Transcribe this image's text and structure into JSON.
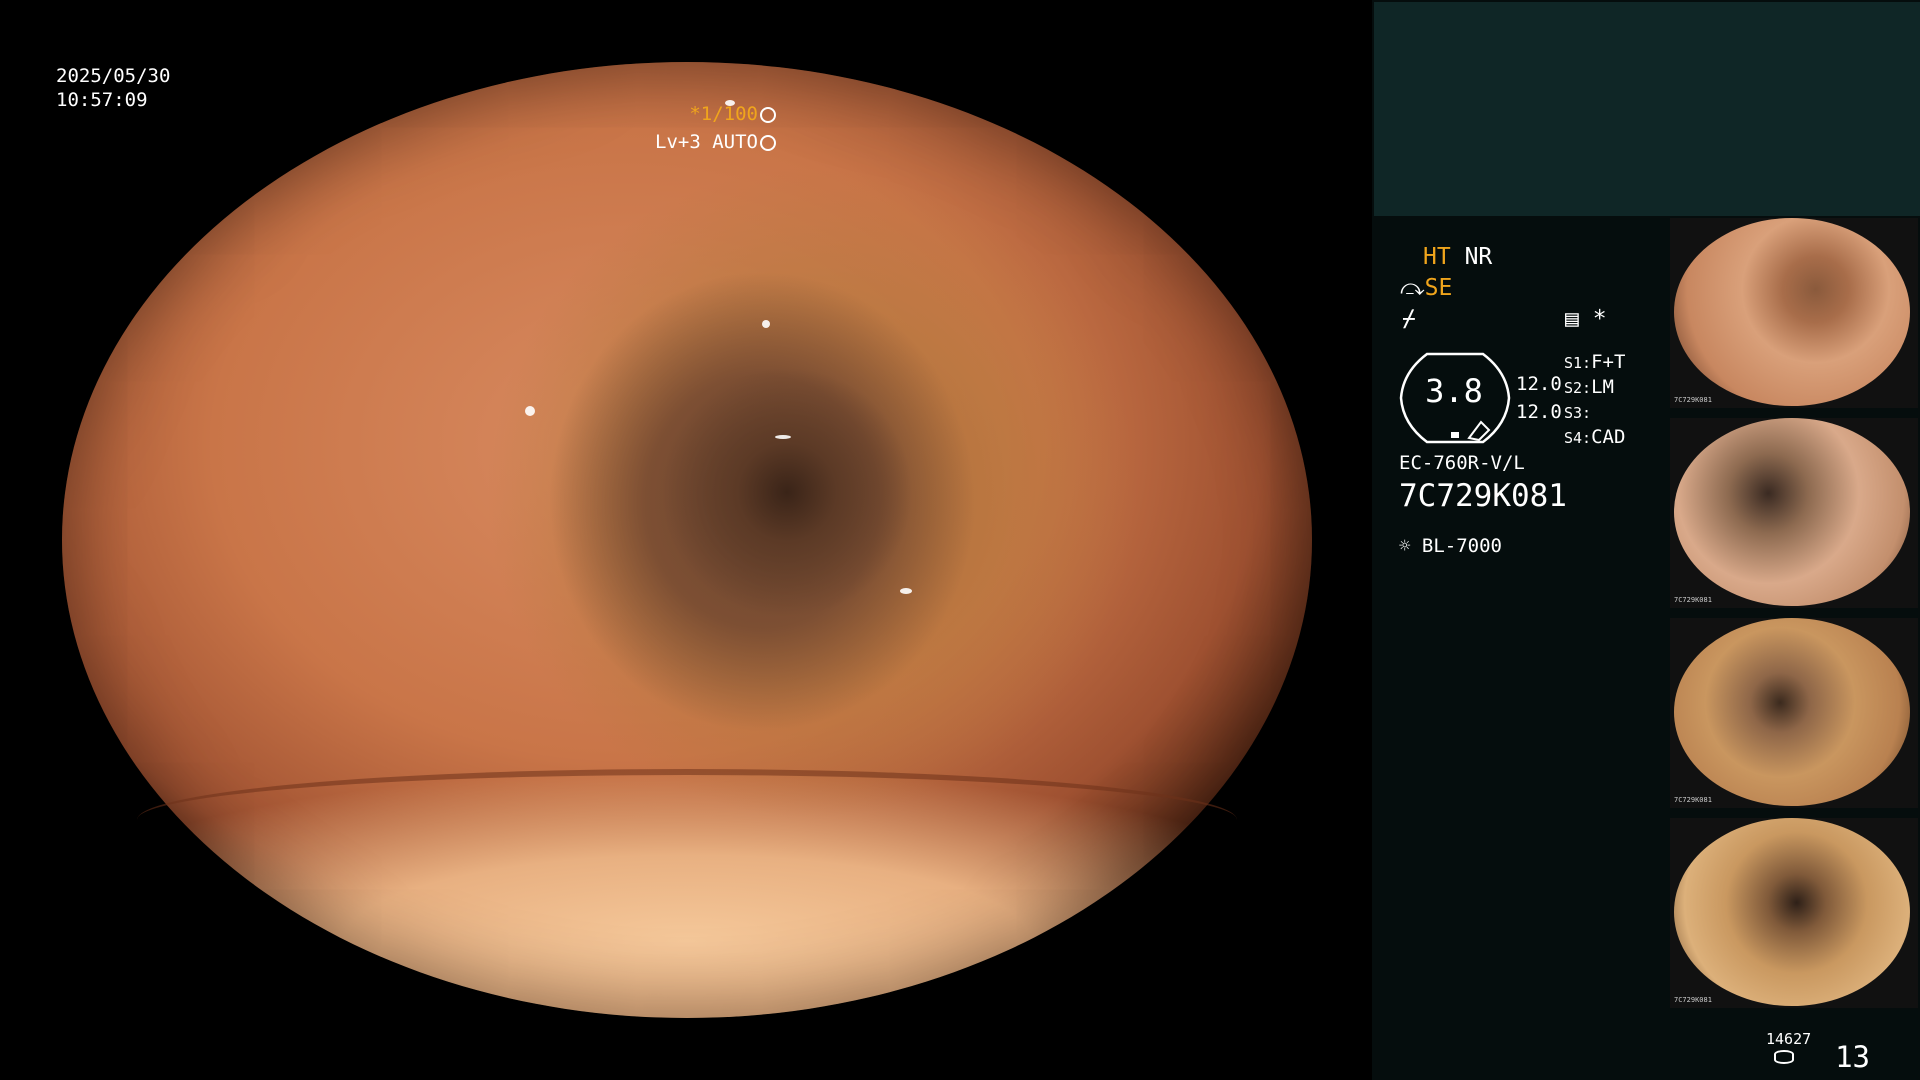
{
  "main": {
    "date": "2025/05/30",
    "time": "10:57:09",
    "shutter": "*1/100",
    "level": "Lv+3",
    "mode": "AUTO"
  },
  "panel": {
    "ht": "HT",
    "nr": "NR",
    "se": "SE",
    "asterisk": "*",
    "iris_value": "3.8",
    "left_values": [
      "12.0",
      "12.0"
    ],
    "presets": [
      {
        "key": "S1:",
        "value": "F+T"
      },
      {
        "key": "S2:",
        "value": "LM"
      },
      {
        "key": "S3:",
        "value": ""
      },
      {
        "key": "S4:",
        "value": "CAD"
      }
    ],
    "scope_model": "EC-760R-V/L",
    "scope_serial": "7C729K081",
    "light_source": "BL-7000",
    "storage_count": "14627",
    "image_count": "13"
  },
  "thumbnails": [
    {
      "caption": "7C729K081"
    },
    {
      "caption": "7C729K081"
    },
    {
      "caption": "7C729K081"
    },
    {
      "caption": "7C729K081"
    }
  ],
  "colors": {
    "accent_orange": "#f0a51c",
    "panel_bg": "#050d0d",
    "top_block": "#0f2626"
  }
}
